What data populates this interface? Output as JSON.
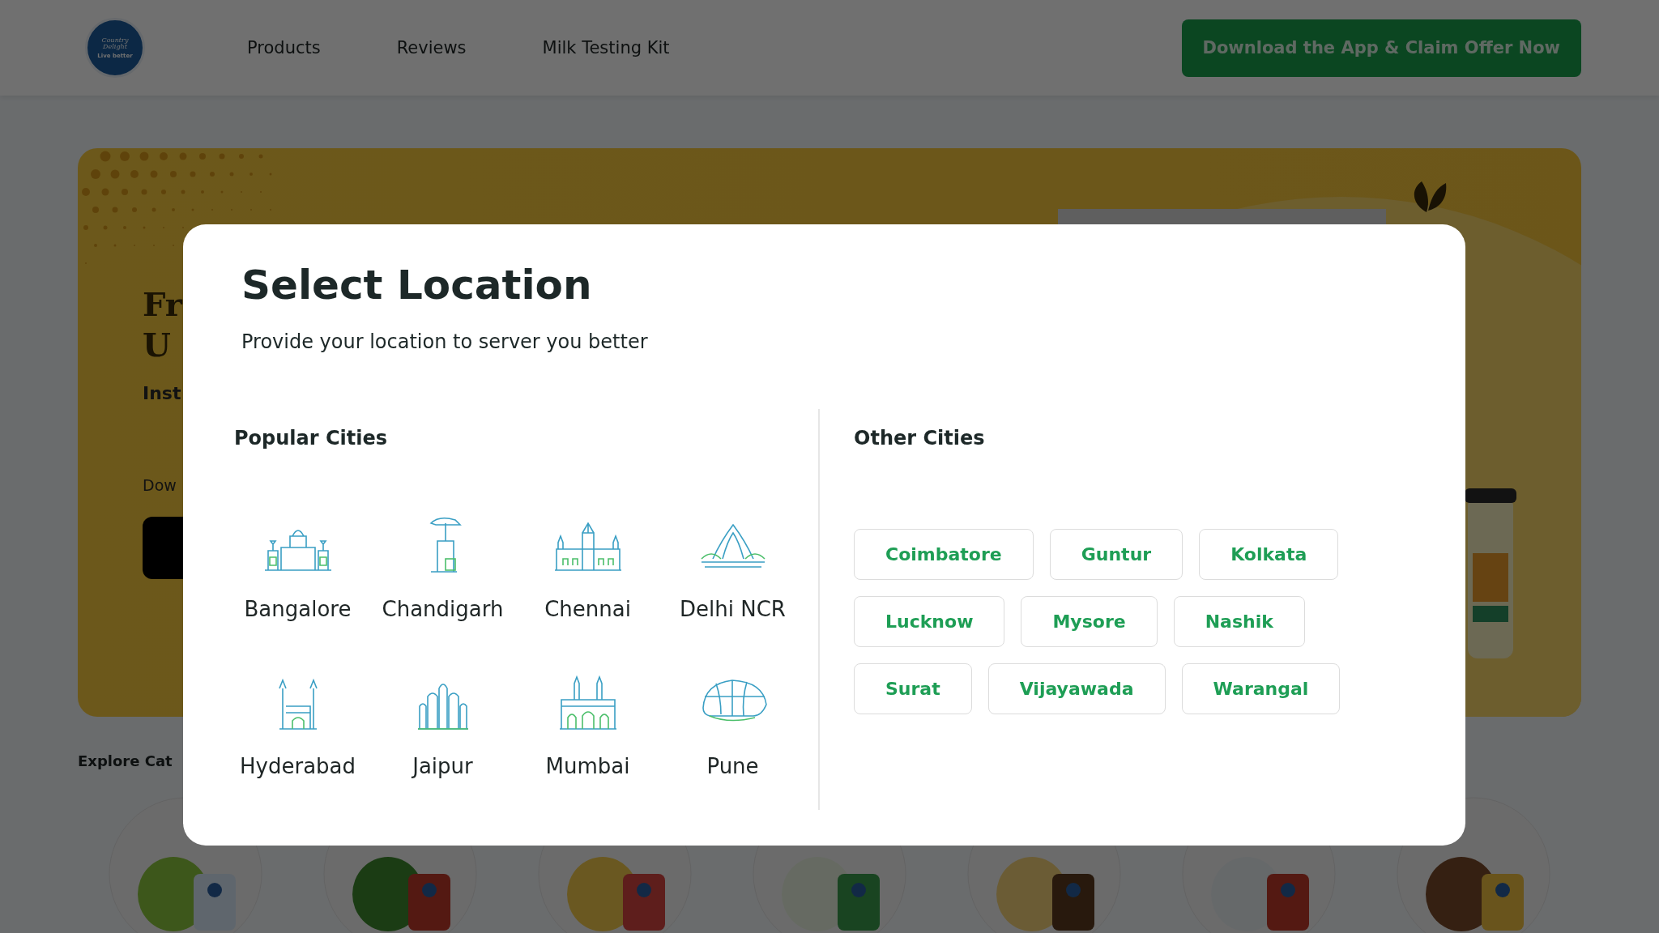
{
  "header": {
    "logo": {
      "name": "Country Delight",
      "tagline": "Live better"
    },
    "nav": [
      {
        "label": "Products"
      },
      {
        "label": "Reviews"
      },
      {
        "label": "Milk Testing Kit"
      }
    ],
    "cta": "Download the App & Claim Offer Now"
  },
  "hero": {
    "title_lines": [
      "Fr",
      "U"
    ],
    "subtitle": "Inst",
    "download_label": "Dow"
  },
  "explore": {
    "heading": "Explore Cat"
  },
  "modal": {
    "title": "Select Location",
    "subtitle": "Provide your location to server you better",
    "popular": {
      "heading": "Popular Cities",
      "cities": [
        {
          "name": "Bangalore"
        },
        {
          "name": "Chandigarh"
        },
        {
          "name": "Chennai"
        },
        {
          "name": "Delhi NCR"
        },
        {
          "name": "Hyderabad"
        },
        {
          "name": "Jaipur"
        },
        {
          "name": "Mumbai"
        },
        {
          "name": "Pune"
        }
      ]
    },
    "other": {
      "heading": "Other Cities",
      "cities": [
        "Coimbatore",
        "Guntur",
        "Kolkata",
        "Lucknow",
        "Mysore",
        "Nashik",
        "Surat",
        "Vijayawada",
        "Warangal"
      ]
    }
  }
}
